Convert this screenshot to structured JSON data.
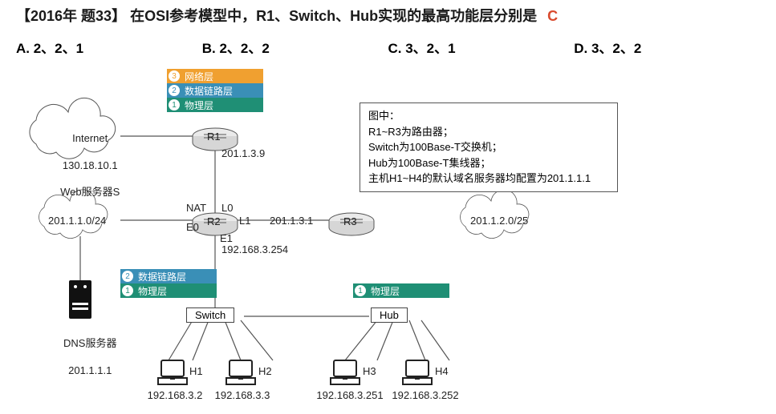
{
  "question": {
    "prefix": "【2016年 题33】",
    "text": "在OSI参考模型中，R1、Switch、Hub实现的最高功能层分别是",
    "answer": "C"
  },
  "options": {
    "a": "A. 2、2、1",
    "b": "B. 2、2、2",
    "c": "C. 3、2、1",
    "d": "D. 3、2、2"
  },
  "layers": {
    "l3": "网络层",
    "l2": "数据链路层",
    "l1": "物理层",
    "n3": "3",
    "n2": "2",
    "n1": "1"
  },
  "legend": {
    "title": "图中：",
    "l1": "R1~R3为路由器；",
    "l2": "Switch为100Base-T交换机；",
    "l3": "Hub为100Base-T集线器；",
    "l4": "主机H1~H4的默认域名服务器均配置为201.1.1.1"
  },
  "clouds": {
    "internet": {
      "t1": "Internet",
      "t2": "130.18.10.1",
      "t3": "Web服务器S"
    },
    "c1": "201.1.1.0/24",
    "c2": "201.1.2.0/25"
  },
  "routers": {
    "r1": "R1",
    "r2": "R2",
    "r3": "R3"
  },
  "ifaces": {
    "r1down": "201.1.3.9",
    "nat": "NAT",
    "l0": "L0",
    "l1": "L1",
    "e0": "E0",
    "e1": "E1",
    "r3ip": "201.1.3.1",
    "r2e1": "192.168.3.254"
  },
  "devices": {
    "switch": "Switch",
    "hub": "Hub",
    "dns": {
      "t1": "DNS服务器",
      "t2": "201.1.1.1"
    }
  },
  "hosts": {
    "h1": {
      "n": "H1",
      "ip": "192.168.3.2"
    },
    "h2": {
      "n": "H2",
      "ip": "192.168.3.3"
    },
    "h3": {
      "n": "H3",
      "ip": "192.168.3.251"
    },
    "h4": {
      "n": "H4",
      "ip": "192.168.3.252"
    }
  }
}
